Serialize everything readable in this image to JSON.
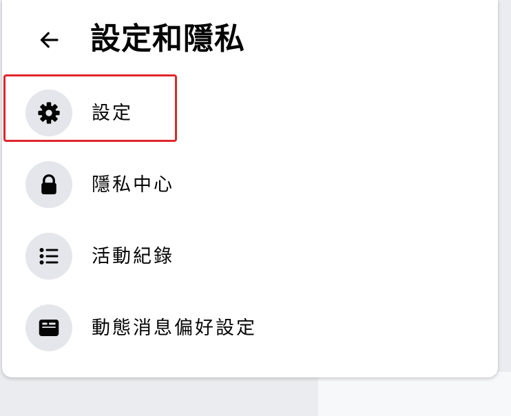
{
  "header": {
    "back_icon": "arrow-left-icon",
    "title": "設定和隱私"
  },
  "menu": {
    "items": [
      {
        "label": "設定",
        "icon": "gear-icon",
        "highlighted": true
      },
      {
        "label": "隱私中心",
        "icon": "lock-icon",
        "highlighted": false
      },
      {
        "label": "活動紀錄",
        "icon": "list-icon",
        "highlighted": false
      },
      {
        "label": "動態消息偏好設定",
        "icon": "news-feed-icon",
        "highlighted": false
      }
    ]
  },
  "colors": {
    "icon_bg": "#e4e6eb",
    "text": "#050505",
    "highlight": "#e0262a",
    "panel_bg": "#ffffff"
  }
}
